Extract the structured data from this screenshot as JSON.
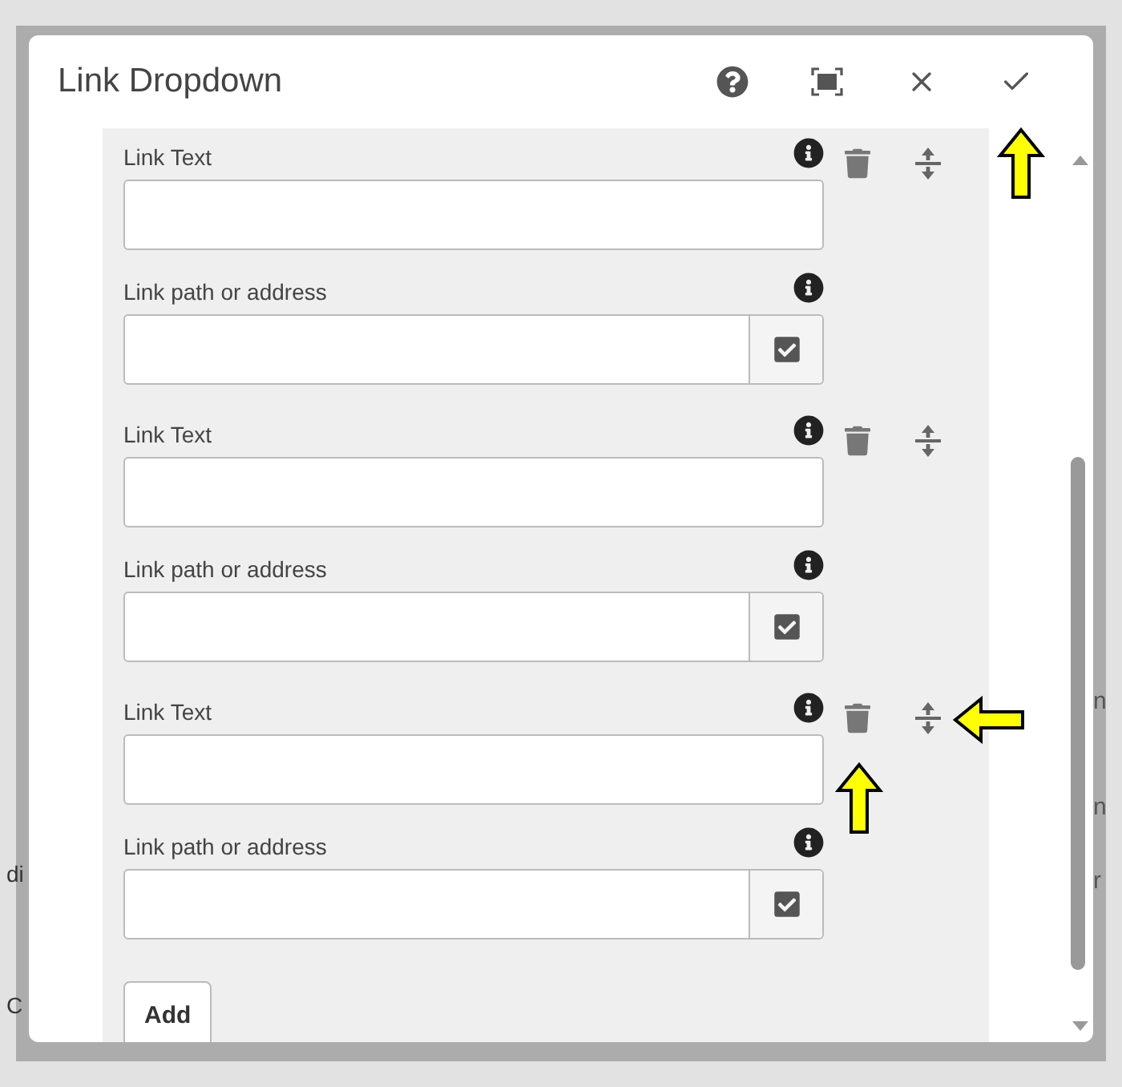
{
  "background_texts": {
    "left": [
      "di",
      "C"
    ],
    "right": [
      "n",
      "n",
      "r"
    ]
  },
  "dialog": {
    "title": "Link Dropdown",
    "toolbar": [
      {
        "kind": "help"
      },
      {
        "kind": "fullscreen"
      },
      {
        "kind": "close"
      },
      {
        "kind": "done"
      }
    ],
    "items": [
      {
        "text_label": "Link Text",
        "path_label": "Link path or address"
      },
      {
        "text_label": "Link Text",
        "path_label": "Link path or address"
      },
      {
        "text_label": "Link Text",
        "path_label": "Link path or address"
      }
    ],
    "add_button": "Add"
  }
}
